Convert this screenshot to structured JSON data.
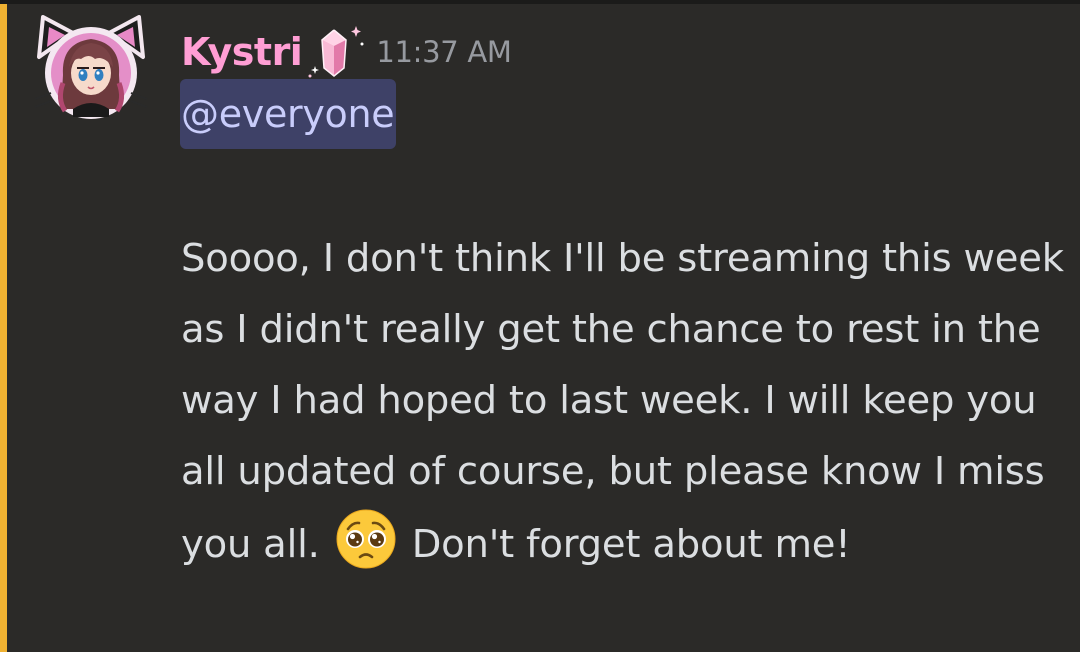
{
  "message": {
    "author": "Kystri",
    "role_icon": "pink-crystal-gem-icon",
    "timestamp": "11:37 AM",
    "mention": "@everyone",
    "body_part1": "Soooo, I don't think I'll be streaming this week as I didn't really get the chance to rest in the way I had hoped to last week. I will keep you all updated of course, but please know I miss you all.",
    "emoji": "pleading-face-emoji",
    "body_part2": "Don't forget about me!"
  },
  "colors": {
    "background": "#2b2a28",
    "mention_bar": "#f0b232",
    "username": "#ff9ed4",
    "mention_bg": "#3e4167",
    "mention_text": "#c9cdfb",
    "body_text": "#dbdee1",
    "timestamp": "#979aa0"
  }
}
